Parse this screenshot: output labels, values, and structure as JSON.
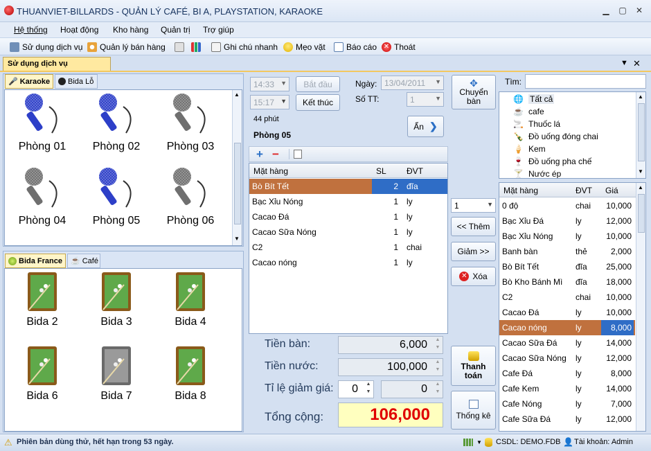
{
  "window": {
    "title": "THUANVIET-BILLARDS - QUẢN LÝ CAFÉ, BI A, PLAYSTATION, KARAOKE"
  },
  "menu": [
    "Hệ thống",
    "Hoạt động",
    "Kho hàng",
    "Quản trị",
    "Trợ giúp"
  ],
  "toolbar": {
    "su_dung": "Sử dụng dịch vụ",
    "quan_ly_ban_hang": "Quản lý bán hàng",
    "ghi_chu": "Ghi chú nhanh",
    "meo_vat": "Mẹo vặt",
    "bao_cao": "Báo cáo",
    "thoat": "Thoát"
  },
  "doc_tab": "Sử dụng dịch vụ",
  "top_tabs": {
    "karaoke": "Karaoke",
    "bida_lo": "Bida Lỗ"
  },
  "rooms": [
    "Phòng 01",
    "Phòng 02",
    "Phòng 03",
    "Phòng 04",
    "Phòng 05",
    "Phòng 06"
  ],
  "bottom_tabs": {
    "bida_france": "Bida France",
    "cafe": "Café"
  },
  "tables": [
    "Bida 2",
    "Bida 3",
    "Bida 4",
    "Bida 6",
    "Bida 7",
    "Bida 8"
  ],
  "session": {
    "start_time": "14:33",
    "end_time": "15:17",
    "bat_dau": "Bắt đầu",
    "ket_thuc": "Kết thúc",
    "ngay_label": "Ngày:",
    "ngay_value": "13/04/2011",
    "sott_label": "Số TT:",
    "sott_value": "1",
    "duration": "44 phút",
    "room": "Phòng 05",
    "an": "Ẩn",
    "chuyen_ban": "Chuyển bàn"
  },
  "order": {
    "headers": [
      "Mặt hàng",
      "SL",
      "ĐVT"
    ],
    "rows": [
      {
        "name": "Bò Bít Tết",
        "qty": "2",
        "unit": "đĩa"
      },
      {
        "name": "Bạc Xỉu Nóng",
        "qty": "1",
        "unit": "ly"
      },
      {
        "name": "Cacao Đá",
        "qty": "1",
        "unit": "ly"
      },
      {
        "name": "Cacao Sữa Nóng",
        "qty": "1",
        "unit": "ly"
      },
      {
        "name": "C2",
        "qty": "1",
        "unit": "chai"
      },
      {
        "name": "Cacao nóng",
        "qty": "1",
        "unit": "ly"
      }
    ]
  },
  "actions": {
    "qty": "1",
    "them": "<< Thêm",
    "giam": "Giảm >>",
    "xoa": "Xóa",
    "thanh_toan": "Thanh toán",
    "thong_ke": "Thống kê"
  },
  "totals": {
    "tien_ban_label": "Tiền bàn:",
    "tien_ban": "6,000",
    "tien_nuoc_label": "Tiền nước:",
    "tien_nuoc": "100,000",
    "giam_gia_label": "Tỉ lệ giảm giá:",
    "giam_gia_pct": "0",
    "giam_gia_amt": "0",
    "tong_label": "Tổng cộng:",
    "tong": "106,000"
  },
  "search": {
    "label": "Tìm:",
    "value": ""
  },
  "categories": [
    "Tất cả",
    "cafe",
    "Thuốc lá",
    "Đồ uống đóng chai",
    "Kem",
    "Đồ uống pha chế",
    "Nước ép"
  ],
  "menu_list": {
    "headers": [
      "Mặt hàng",
      "ĐVT",
      "Giá"
    ],
    "rows": [
      {
        "name": "0 độ",
        "unit": "chai",
        "price": "10,000"
      },
      {
        "name": "Bạc Xỉu Đá",
        "unit": "ly",
        "price": "12,000"
      },
      {
        "name": "Bạc Xỉu Nóng",
        "unit": "ly",
        "price": "10,000"
      },
      {
        "name": "Banh bàn",
        "unit": "thẻ",
        "price": "2,000"
      },
      {
        "name": "Bò Bít Tết",
        "unit": "đĩa",
        "price": "25,000"
      },
      {
        "name": "Bò Kho Bánh Mì",
        "unit": "đĩa",
        "price": "18,000"
      },
      {
        "name": "C2",
        "unit": "chai",
        "price": "10,000"
      },
      {
        "name": "Cacao Đá",
        "unit": "ly",
        "price": "10,000"
      },
      {
        "name": "Cacao nóng",
        "unit": "ly",
        "price": "8,000"
      },
      {
        "name": "Cacao Sữa Đá",
        "unit": "ly",
        "price": "14,000"
      },
      {
        "name": "Cacao Sữa Nóng",
        "unit": "ly",
        "price": "12,000"
      },
      {
        "name": "Cafe Đá",
        "unit": "ly",
        "price": "8,000"
      },
      {
        "name": "Cafe Kem",
        "unit": "ly",
        "price": "14,000"
      },
      {
        "name": "Cafe Nóng",
        "unit": "ly",
        "price": "7,000"
      },
      {
        "name": "Cafe Sữa Đá",
        "unit": "ly",
        "price": "12,000"
      }
    ]
  },
  "status": {
    "message": "Phiên bản dùng thử, hết hạn trong 53 ngày.",
    "db": "CSDL: DEMO.FDB",
    "account": "Tài khoản: Admin"
  },
  "colors": {
    "selected_row": "#c0713e",
    "selected_cell": "#2f6dc6",
    "total_red": "#e00000",
    "mic_active": "#2d3fc8",
    "mic_inactive": "#6f6f6f"
  }
}
